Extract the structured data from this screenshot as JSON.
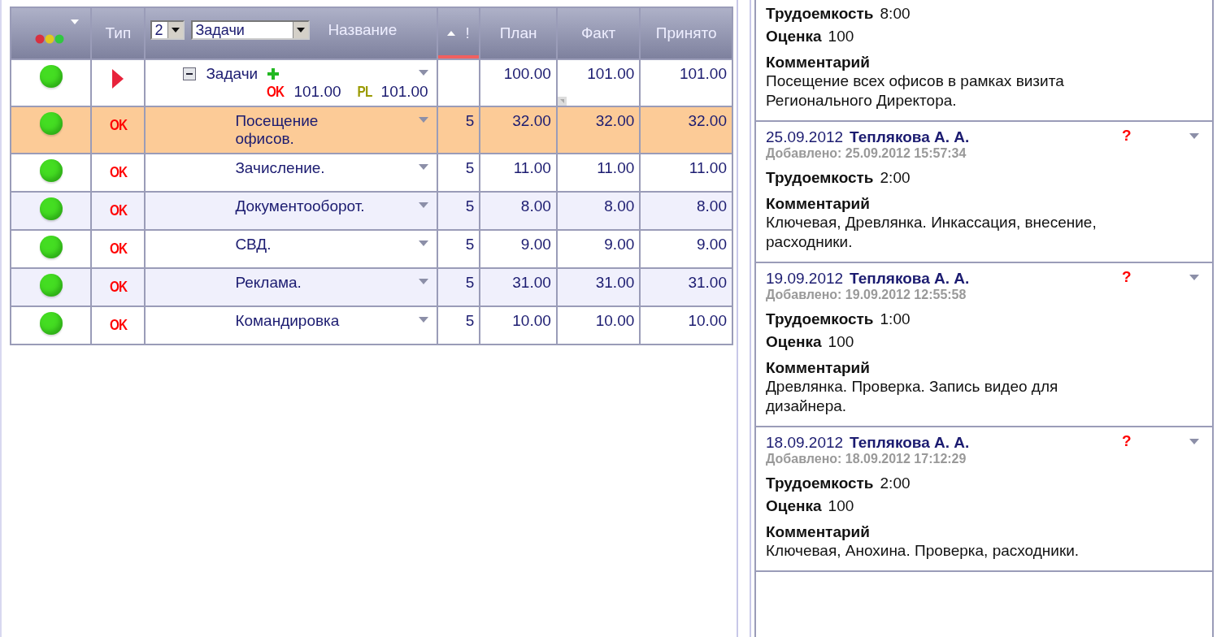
{
  "header": {
    "type_label": "Тип",
    "level_select": "2",
    "group_select": "Задачи",
    "name_label": "Название",
    "priority_label": "!",
    "plan_label": "План",
    "fact_label": "Факт",
    "accepted_label": "Принято"
  },
  "rows": [
    {
      "kind": "group",
      "selected": false,
      "color": "#44dd22",
      "name": "Задачи",
      "expanded": true,
      "totals": {
        "ok_label": "OK",
        "ok_value": "101.00",
        "pl_label": "PL",
        "pl_value": "101.00"
      },
      "plan": "100.00",
      "fact": "101.00",
      "accepted": "101.00"
    },
    {
      "kind": "task",
      "selected": true,
      "color": "#44dd22",
      "type": "OK",
      "name": "Посещение офисов.",
      "priority": "5",
      "plan": "32.00",
      "fact": "32.00",
      "accepted": "32.00"
    },
    {
      "kind": "task",
      "selected": false,
      "color": "#44dd22",
      "type": "OK",
      "name": "Зачисление.",
      "priority": "5",
      "plan": "11.00",
      "fact": "11.00",
      "accepted": "11.00"
    },
    {
      "kind": "task",
      "selected": false,
      "color": "#44dd22",
      "type": "OK",
      "name": "Документооборот.",
      "priority": "5",
      "plan": "8.00",
      "fact": "8.00",
      "accepted": "8.00"
    },
    {
      "kind": "task",
      "selected": false,
      "color": "#44dd22",
      "type": "OK",
      "name": "СВД.",
      "priority": "5",
      "plan": "9.00",
      "fact": "9.00",
      "accepted": "9.00"
    },
    {
      "kind": "task",
      "selected": false,
      "color": "#44dd22",
      "type": "OK",
      "name": "Реклама.",
      "priority": "5",
      "plan": "31.00",
      "fact": "31.00",
      "accepted": "31.00"
    },
    {
      "kind": "task",
      "selected": false,
      "color": "#44dd22",
      "type": "OK",
      "name": "Командировка",
      "priority": "5",
      "plan": "10.00",
      "fact": "10.00",
      "accepted": "10.00"
    }
  ],
  "entries": [
    {
      "fields": [
        {
          "label": "Трудоемкость",
          "value": "8:00"
        },
        {
          "label": "Оценка",
          "value": "100"
        }
      ],
      "comment_label": "Комментарий",
      "comment": "Посещение всех офисов в рамках визита Регионального Директора."
    },
    {
      "date": "25.09.2012",
      "author": "Теплякова А. А.",
      "flag": "?",
      "added": "Добавлено: 25.09.2012 15:57:34",
      "fields": [
        {
          "label": "Трудоемкость",
          "value": "2:00"
        }
      ],
      "comment_label": "Комментарий",
      "comment": "Ключевая, Древлянка. Инкассация, внесение, расходники."
    },
    {
      "date": "19.09.2012",
      "author": "Теплякова А. А.",
      "flag": "?",
      "added": "Добавлено: 19.09.2012 12:55:58",
      "fields": [
        {
          "label": "Трудоемкость",
          "value": "1:00"
        },
        {
          "label": "Оценка",
          "value": "100"
        }
      ],
      "comment_label": "Комментарий",
      "comment": "Древлянка. Проверка. Запись видео для дизайнера."
    },
    {
      "date": "18.09.2012",
      "author": "Теплякова А. А.",
      "flag": "?",
      "added": "Добавлено: 18.09.2012 17:12:29",
      "fields": [
        {
          "label": "Трудоемкость",
          "value": "2:00"
        },
        {
          "label": "Оценка",
          "value": "100"
        }
      ],
      "comment_label": "Комментарий",
      "comment": "Ключевая, Анохина. Проверка, расходники."
    }
  ]
}
